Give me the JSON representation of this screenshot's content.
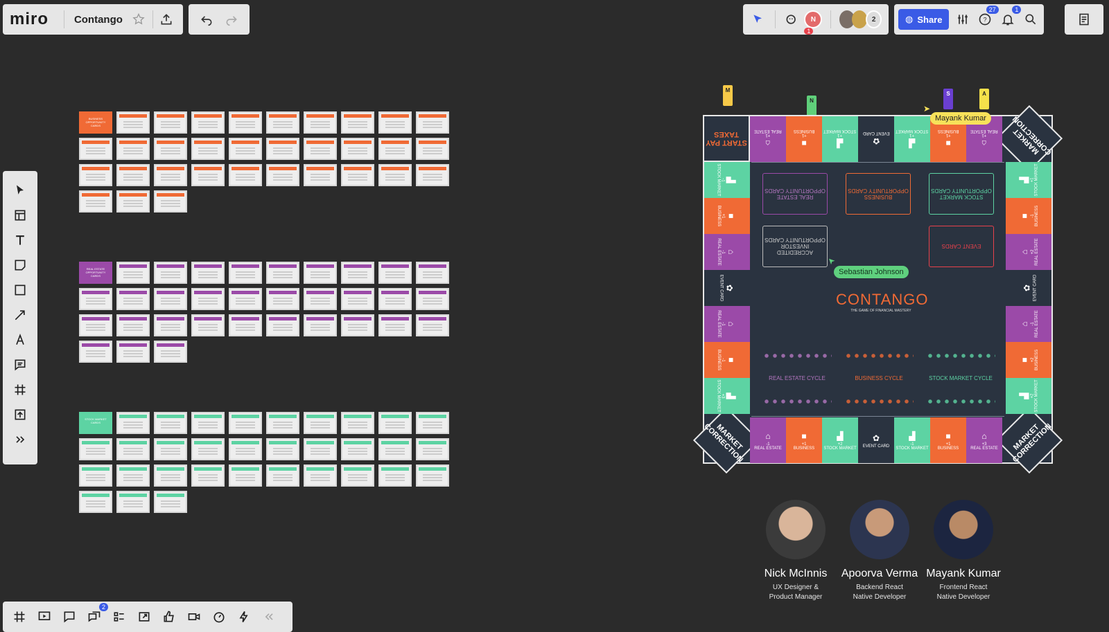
{
  "topbar": {
    "logo": "miro",
    "board_title": "Contango",
    "collaborators_extra": "2",
    "presence_count": "1",
    "share_label": "Share",
    "help_badge": "27",
    "notifications_badge": "1",
    "current_user_initial": "N"
  },
  "groups": [
    {
      "name": "business",
      "color": "#f06a35",
      "header": "BUSINESS OPPORTUNITY CARDS",
      "count": 33
    },
    {
      "name": "realestate",
      "color": "#9b4aa8",
      "header": "REAL ESTATE OPPORTUNITY CARDS",
      "count": 33
    },
    {
      "name": "stock",
      "color": "#5dd3a3",
      "header": "STOCK MARKET CARDS",
      "count": 33
    }
  ],
  "board": {
    "corners": {
      "tl": "START PAY TAXES",
      "tr": "MARKET CORRECTION",
      "bl": "MARKET CORRECTION",
      "br": "MARKET CORRECTION"
    },
    "decks": {
      "realestate": "REAL ESTATE OPPORTUNITY CARDS",
      "business": "BUSINESS OPPORTUNITY CARDS",
      "stock": "STOCK MARKET OPPORTUNITY CARDS",
      "investor": "ACCREDITED INVESTOR OPPORTUNITY CARDS",
      "event": "EVENT CARDS"
    },
    "logo_title": "CONTANGO",
    "logo_subtitle": "THE GAME OF FINANCIAL MASTERY",
    "cycles": {
      "realestate": "REAL ESTATE CYCLE",
      "business": "BUSINESS CYCLE",
      "stock": "STOCK MARKET CYCLE"
    },
    "bottom_cells": [
      {
        "label": "REAL ESTATE",
        "value": "-1",
        "color": "#9b4aa8",
        "glyph": "⌂"
      },
      {
        "label": "BUSINESS",
        "value": "+1",
        "color": "#f06a35",
        "glyph": "■"
      },
      {
        "label": "STOCK MARKET",
        "value": "+2",
        "color": "#5dd3a3",
        "glyph": "▟"
      },
      {
        "label": "EVENT CARD",
        "value": "",
        "color": "#2a3340",
        "glyph": "✿"
      },
      {
        "label": "STOCK MARKET",
        "value": "-1",
        "color": "#5dd3a3",
        "glyph": "▟"
      },
      {
        "label": "BUSINESS",
        "value": "+1",
        "color": "#f06a35",
        "glyph": "■"
      },
      {
        "label": "REAL ESTATE",
        "value": "+3",
        "color": "#9b4aa8",
        "glyph": "⌂"
      }
    ],
    "top_cells": [
      {
        "label": "REAL ESTATE",
        "value": "+1",
        "color": "#9b4aa8",
        "glyph": "⌂"
      },
      {
        "label": "BUSINESS",
        "value": "+1",
        "color": "#f06a35",
        "glyph": "■"
      },
      {
        "label": "STOCK MARKET",
        "value": "+1",
        "color": "#5dd3a3",
        "glyph": "▟"
      },
      {
        "label": "EVENT CARD",
        "value": "",
        "color": "#2a3340",
        "glyph": "✿"
      },
      {
        "label": "STOCK MARKET",
        "value": "+1",
        "color": "#5dd3a3",
        "glyph": "▟"
      },
      {
        "label": "BUSINESS",
        "value": "+1",
        "color": "#f06a35",
        "glyph": "■"
      },
      {
        "label": "REAL ESTATE",
        "value": "+1",
        "color": "#9b4aa8",
        "glyph": "⌂"
      }
    ],
    "left_cells": [
      {
        "label": "STOCK MARKET",
        "value": "-1",
        "color": "#5dd3a3",
        "glyph": "▟"
      },
      {
        "label": "BUSINESS",
        "value": "+1",
        "color": "#f06a35",
        "glyph": "■"
      },
      {
        "label": "REAL ESTATE",
        "value": "-1",
        "color": "#9b4aa8",
        "glyph": "⌂"
      },
      {
        "label": "EVENT CARD",
        "value": "",
        "color": "#2a3340",
        "glyph": "✿"
      },
      {
        "label": "REAL ESTATE",
        "value": "-1",
        "color": "#9b4aa8",
        "glyph": "⌂"
      },
      {
        "label": "BUSINESS",
        "value": "-1",
        "color": "#f06a35",
        "glyph": "■"
      },
      {
        "label": "STOCK MARKET",
        "value": "+3",
        "color": "#5dd3a3",
        "glyph": "▟"
      }
    ],
    "right_cells": [
      {
        "label": "STOCK MARKET",
        "value": "+1",
        "color": "#5dd3a3",
        "glyph": "▟"
      },
      {
        "label": "BUSINESS",
        "value": "-1",
        "color": "#f06a35",
        "glyph": "■"
      },
      {
        "label": "REAL ESTATE",
        "value": "+2",
        "color": "#9b4aa8",
        "glyph": "⌂"
      },
      {
        "label": "EVENT CARD",
        "value": "",
        "color": "#2a3340",
        "glyph": "✿"
      },
      {
        "label": "REAL ESTATE",
        "value": "-1",
        "color": "#9b4aa8",
        "glyph": "⌂"
      },
      {
        "label": "BUSINESS",
        "value": "+2",
        "color": "#f06a35",
        "glyph": "■"
      },
      {
        "label": "STOCK MARKET",
        "value": "+2",
        "color": "#5dd3a3",
        "glyph": "▟"
      }
    ]
  },
  "cursors": {
    "mayank": "Mayank Kumar",
    "sebastian": "Sebastian Johnson"
  },
  "pins": {
    "m": "M",
    "n": "N",
    "s": "S",
    "a": "A"
  },
  "people": [
    {
      "name": "Nick McInnis",
      "role1": "UX Designer &",
      "role2": "Product Manager"
    },
    {
      "name": "Apoorva Verma",
      "role1": "Backend React",
      "role2": "Native Developer"
    },
    {
      "name": "Mayank Kumar",
      "role1": "Frontend React",
      "role2": "Native Developer"
    }
  ],
  "bottombar": {
    "badge": "2"
  }
}
